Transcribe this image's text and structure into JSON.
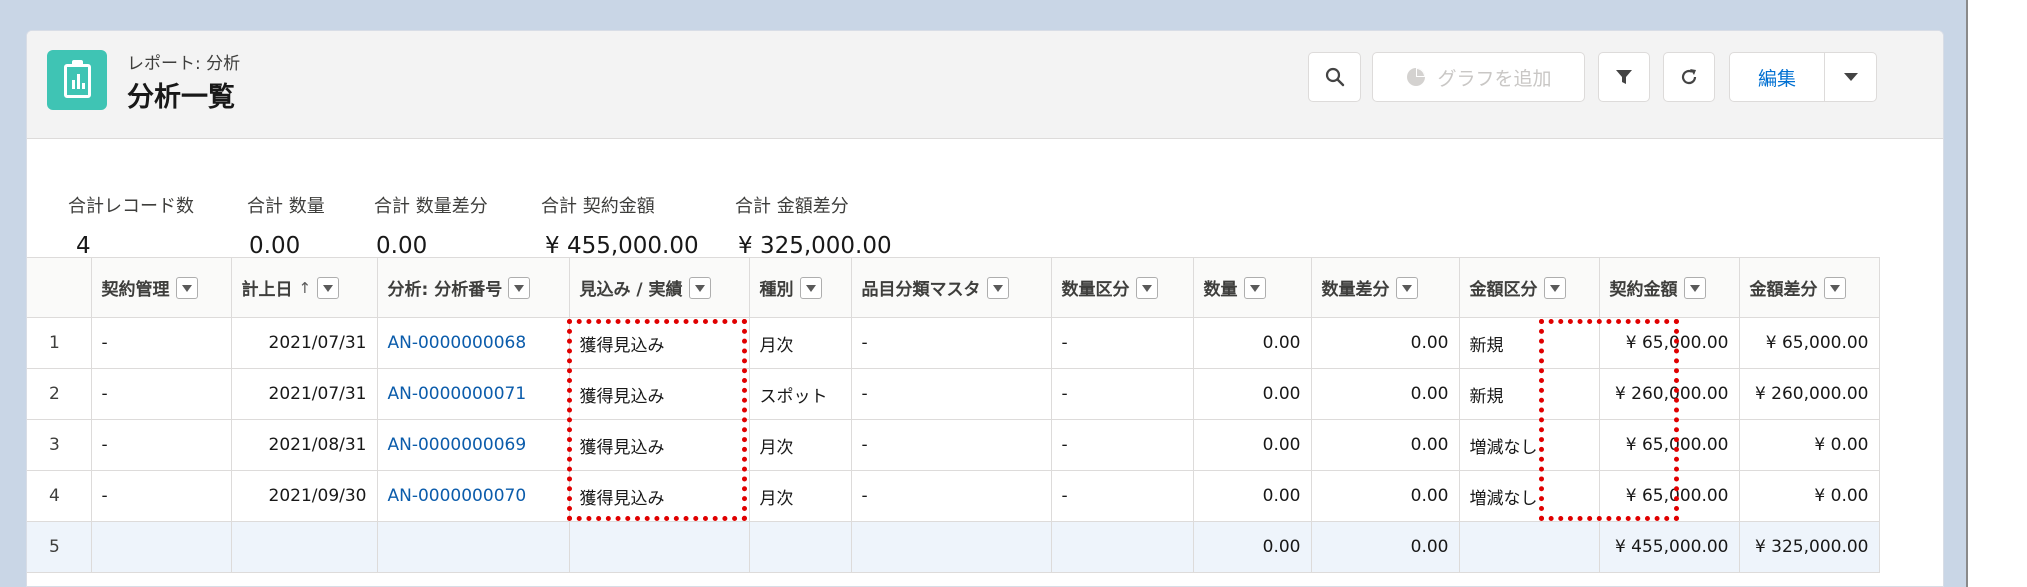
{
  "header": {
    "subtitle": "レポート: 分析",
    "title": "分析一覧",
    "add_chart_label": "グラフを追加",
    "edit_label": "編集"
  },
  "summary": [
    {
      "label": "合計レコード数",
      "value": "4"
    },
    {
      "label": "合計 数量",
      "value": "0.00"
    },
    {
      "label": "合計 数量差分",
      "value": "0.00"
    },
    {
      "label": "合計 契約金額",
      "value": "¥ 455,000.00"
    },
    {
      "label": "合計 金額差分",
      "value": "¥ 325,000.00"
    }
  ],
  "table": {
    "columns": [
      "契約管理",
      "計上日",
      "分析: 分析番号",
      "見込み / 実績",
      "種別",
      "品目分類マスタ",
      "数量区分",
      "数量",
      "数量差分",
      "金額区分",
      "契約金額",
      "金額差分"
    ],
    "sort_indicator": "↑",
    "rows": [
      {
        "n": "1",
        "c": [
          "-",
          "2021/07/31",
          "AN-0000000068",
          "獲得見込み",
          "月次",
          "-",
          "-",
          "0.00",
          "0.00",
          "新規",
          "¥ 65,000.00",
          "¥ 65,000.00"
        ]
      },
      {
        "n": "2",
        "c": [
          "-",
          "2021/07/31",
          "AN-0000000071",
          "獲得見込み",
          "スポット",
          "-",
          "-",
          "0.00",
          "0.00",
          "新規",
          "¥ 260,000.00",
          "¥ 260,000.00"
        ]
      },
      {
        "n": "3",
        "c": [
          "-",
          "2021/08/31",
          "AN-0000000069",
          "獲得見込み",
          "月次",
          "-",
          "-",
          "0.00",
          "0.00",
          "増減なし",
          "¥ 65,000.00",
          "¥ 0.00"
        ]
      },
      {
        "n": "4",
        "c": [
          "-",
          "2021/09/30",
          "AN-0000000070",
          "獲得見込み",
          "月次",
          "-",
          "-",
          "0.00",
          "0.00",
          "増減なし",
          "¥ 65,000.00",
          "¥ 0.00"
        ]
      }
    ],
    "total_row": {
      "n": "5",
      "c": [
        "",
        "",
        "",
        "",
        "",
        "",
        "",
        "0.00",
        "0.00",
        "",
        "¥ 455,000.00",
        "¥ 325,000.00"
      ]
    }
  }
}
